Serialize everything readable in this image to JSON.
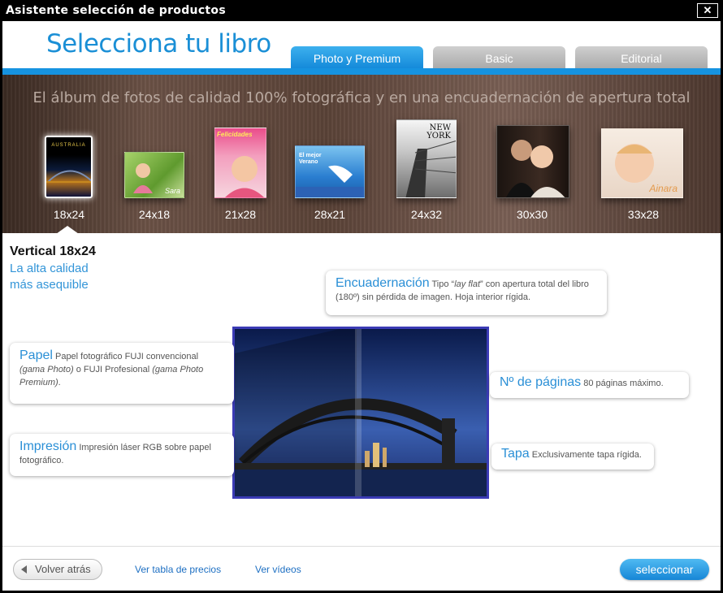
{
  "window": {
    "title": "Asistente selección de productos",
    "close_label": "✕"
  },
  "header": {
    "title": "Selecciona tu libro",
    "tabs": [
      {
        "label": "Photo y Premium",
        "active": true
      },
      {
        "label": "Basic",
        "active": false
      },
      {
        "label": "Editorial",
        "active": false
      }
    ]
  },
  "strip": {
    "tagline": "El álbum de fotos de calidad 100% fotográfica y en una encuadernación de apertura total",
    "formats": [
      {
        "label": "18x24",
        "selected": true,
        "cover_text": "AUSTRALIA"
      },
      {
        "label": "24x18",
        "selected": false,
        "cover_text": "Sara"
      },
      {
        "label": "21x28",
        "selected": false,
        "cover_text": "Felicidades"
      },
      {
        "label": "28x21",
        "selected": false,
        "cover_text": "El mejor Verano"
      },
      {
        "label": "24x32",
        "selected": false,
        "cover_text": "NEW YORK"
      },
      {
        "label": "30x30",
        "selected": false,
        "cover_text": ""
      },
      {
        "label": "33x28",
        "selected": false,
        "cover_text": "Ainara"
      }
    ]
  },
  "product": {
    "name": "Vertical 18x24",
    "subtitle_line1": "La alta calidad",
    "subtitle_line2": "más asequible"
  },
  "features": {
    "binding": {
      "title": "Encuadernación",
      "text_a": "Tipo “",
      "text_em": "lay flat",
      "text_b": "” con apertura total del libro (180º) sin pérdida de imagen. Hoja interior rígida."
    },
    "paper": {
      "title": "Papel",
      "text_a": "Papel fotográfico FUJI convencional ",
      "text_em1": "(gama Photo)",
      "text_b": " o FUJI Profesional ",
      "text_em2": "(gama Photo Premium)",
      "text_c": "."
    },
    "pages": {
      "title": "Nº de páginas",
      "text": "80 páginas máximo."
    },
    "printing": {
      "title": "Impresión",
      "text": "Impresión láser RGB sobre papel fotográfico."
    },
    "cover": {
      "title": "Tapa",
      "text": "Exclusivamente tapa rígida."
    }
  },
  "footer": {
    "back_label": "Volver atrás",
    "prices_link": "Ver tabla de precios",
    "videos_link": "Ver vídeos",
    "select_label": "seleccionar"
  }
}
